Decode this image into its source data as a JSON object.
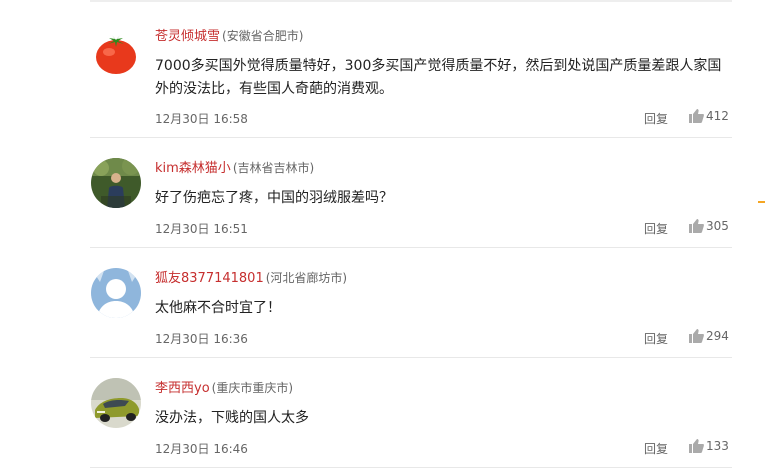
{
  "comments": [
    {
      "username": "苍灵倾城雪",
      "location": "(安徽省合肥市)",
      "content": "7000多买国外觉得质量特好，300多买国产觉得质量不好，然后到处说国产质量差跟人家国外的没法比，有些国人奇葩的消费观。",
      "time": "12月30日 16:58",
      "reply_label": "回复",
      "likes": "412",
      "avatar_icon": "tomato-avatar-icon"
    },
    {
      "username": "kim森林猫小",
      "location": "(吉林省吉林市)",
      "content": "好了伤疤忘了疼，中国的羽绒服差吗？",
      "time": "12月30日 16:51",
      "reply_label": "回复",
      "likes": "305",
      "avatar_icon": "person-photo-avatar-icon"
    },
    {
      "username": "狐友8377141801",
      "location": "(河北省廊坊市)",
      "content": "太他麻不合时宜了！",
      "time": "12月30日 16:36",
      "reply_label": "回复",
      "likes": "294",
      "avatar_icon": "default-user-avatar-icon"
    },
    {
      "username": "李西西yo",
      "location": "(重庆市重庆市)",
      "content": "没办法，下贱的国人太多",
      "time": "12月30日 16:46",
      "reply_label": "回复",
      "likes": "133",
      "avatar_icon": "car-avatar-icon"
    }
  ],
  "colors": {
    "username": "#c62f2f",
    "meta_text": "#666666",
    "body_text": "#222222",
    "divider": "#e8e8e8",
    "accent": "#f5a623"
  }
}
